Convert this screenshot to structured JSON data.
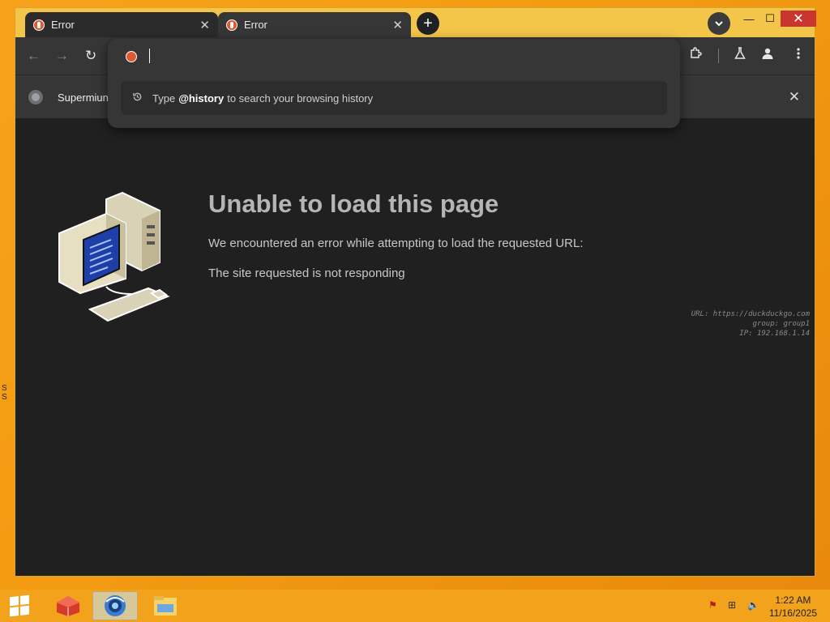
{
  "tabs": [
    {
      "title": "Error",
      "close": "✕"
    },
    {
      "title": "Error",
      "close": "✕"
    }
  ],
  "newtab_label": "+",
  "window_controls": {
    "minimize": "—",
    "maximize": "☐",
    "close": "✕"
  },
  "toolbar": {
    "back": "←",
    "forward": "→",
    "reload": "↻"
  },
  "bookmarks_bar": {
    "label": "Supermiun",
    "close": "✕"
  },
  "omnibox": {
    "hint_keyword": "@history",
    "hint_prefix": "Type",
    "hint_suffix": "to search your browsing history"
  },
  "error_page": {
    "title": "Unable to load this page",
    "message": "We encountered an error while attempting to load the requested URL:",
    "detail": "The site requested is not responding",
    "meta_url": "URL: https://duckduckgo.com",
    "meta_group": "group: group1",
    "meta_ip": "IP: 192.168.1.14"
  },
  "taskbar": {
    "time": "1:22 AM",
    "date": "11/16/2025"
  },
  "colors": {
    "desktop": "#f39c12",
    "window_frame": "#f3c64a",
    "browser_dark": "#363636",
    "content_bg": "#202021",
    "favicon": "#de5833",
    "close_button": "#c8362f"
  },
  "icons": [
    "duckduckgo-favicon-icon",
    "history-icon",
    "extensions-icon",
    "labs-flask-icon",
    "profile-icon",
    "menu-kebab-icon",
    "chromium-logo-icon",
    "pixel-computer-icon",
    "windows-logo-icon"
  ]
}
